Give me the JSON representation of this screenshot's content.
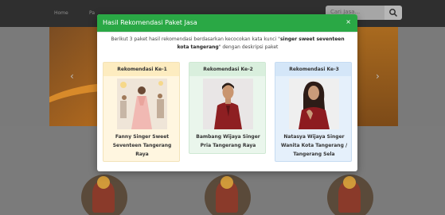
{
  "navbar": {
    "home_label": "Home",
    "second_label": "Pa",
    "search_placeholder": "Cari Jasa..."
  },
  "modal": {
    "title": "Hasil Rekomendasi Paket Jasa",
    "close_symbol": "×",
    "intro_prefix": "Berikut 3 paket hasil rekomendasi berdasarkan kecocokan kata kunci \"",
    "keyword": "singer sweet seventeen kota tangerang",
    "intro_suffix": "\" dengan deskripsi paket",
    "cards": [
      {
        "heading": "Rekomendasi Ke-1",
        "name": "Fanny Singer Sweet Seventeen Tangerang Raya"
      },
      {
        "heading": "Rekomendasi Ke-2",
        "name": "Bambang Wijaya Singer Pria Tangerang Raya"
      },
      {
        "heading": "Rekomendasi Ke-3",
        "name": "Natasya Wijaya Singer Wanita Kota Tangerang / Tangerang Sela"
      }
    ]
  },
  "colors": {
    "header_green": "#2aa845",
    "card1_bg": "#fff6e0",
    "card2_bg": "#eaf6ec",
    "card3_bg": "#e5f0fb"
  }
}
